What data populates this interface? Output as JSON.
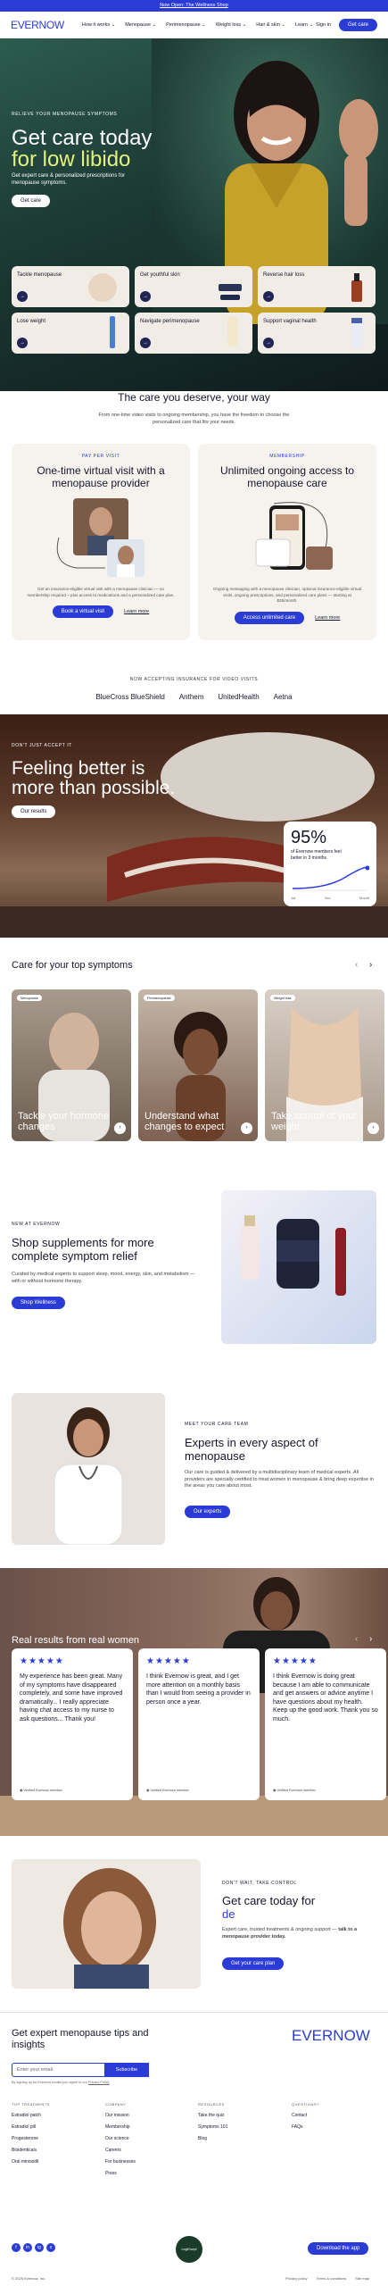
{
  "banner": {
    "text": "Now Open: The Wellness Shop"
  },
  "nav": {
    "logo": "EVERNOW",
    "items": [
      "How it works",
      "Menopause",
      "Perimenopause",
      "Weight loss",
      "Hair & skin",
      "Learn"
    ],
    "sign_in": "Sign in",
    "cta": "Get care"
  },
  "hero": {
    "eyebrow": "RELIEVE YOUR MENOPAUSE SYMPTOMS",
    "title_line1": "Get care today",
    "title_line2": "for low libido",
    "subtitle": "Get expert care & personalized prescriptions for menopause symptoms.",
    "cta": "Get care",
    "cards": [
      {
        "label": "Tackle menopause"
      },
      {
        "label": "Get youthful skin"
      },
      {
        "label": "Reverse hair loss"
      },
      {
        "label": "Lose weight"
      },
      {
        "label": "Navigate perimenopause"
      },
      {
        "label": "Support vaginal health"
      }
    ]
  },
  "care": {
    "title": "The care you deserve, your way",
    "subtitle": "From one-time video visits to ongoing membership, you have the freedom to choose the personalized care that fits your needs.",
    "cards": [
      {
        "eyebrow": "PAY PER VISIT",
        "title": "One-time virtual visit with a menopause provider",
        "desc": "Get an insurance-eligible virtual visit with a menopause clinician — no membership required – plus access to medications and a personalized care plan.",
        "cta": "Book a virtual visit",
        "link": "Learn more"
      },
      {
        "eyebrow": "MEMBERSHIP",
        "title": "Unlimited ongoing access to menopause care",
        "desc": "Ongoing messaging with a menopause clinician, optional insurance-eligible virtual visits, ongoing prescriptions, and personalized care plans — starting at $35/month.",
        "cta": "Access unlimited care",
        "link": "Learn more"
      }
    ]
  },
  "insurance": {
    "heading": "NOW ACCEPTING INSURANCE FOR VIDEO VISITS",
    "providers": [
      "BlueCross BlueShield",
      "Anthem",
      "UnitedHealth",
      "Aetna"
    ]
  },
  "feel": {
    "eyebrow": "DON'T JUST ACCEPT IT",
    "title_line1": "Feeling better is",
    "title_line2": "more than possible.",
    "cta": "Our results",
    "stat_value": "95%",
    "stat_text": "of Evernow members feel better in 3 months",
    "stat_axis": [
      "1st",
      "2nd",
      "Month"
    ]
  },
  "symptoms": {
    "title": "Care for your top symptoms",
    "cards": [
      {
        "tag": "Menopause",
        "title": "Tackle your hormone changes"
      },
      {
        "tag": "Perimenopause",
        "title": "Understand what changes to expect"
      },
      {
        "tag": "Weight loss",
        "title": "Take control of your weight"
      }
    ]
  },
  "supplements": {
    "eyebrow": "NEW AT EVERNOW",
    "title": "Shop supplements for more complete symptom relief",
    "desc": "Curated by medical experts to support sleep, mood, energy, skin, and metabolism — with or without hormone therapy.",
    "cta": "Shop Wellness"
  },
  "team": {
    "eyebrow": "MEET YOUR CARE TEAM",
    "title": "Experts in every aspect of menopause",
    "desc": "Our care is guided & delivered by a multidisciplinary team of medical experts. All providers are specially certified to treat women in menopause & bring deep expertise in the areas you care about most.",
    "cta": "Our experts"
  },
  "reviews": {
    "title": "Real results from real women",
    "items": [
      {
        "stars": "★★★★★",
        "text": "My experience has been great. Many of my symptoms have disappeared completely, and some have improved dramatically... I really appreciate having chat access to my nurse to ask questions... Thank you!",
        "verified": "Verified Evernow member"
      },
      {
        "stars": "★★★★★",
        "text": "I think Evernow is great, and I get more attention on a monthly basis than I would from seeing a provider in person once a year.",
        "verified": "Verified Evernow member"
      },
      {
        "stars": "★★★★★",
        "text": "I think Evernow is doing great because I am able to communicate and get answers or advice anytime I have questions about my health. Keep up the good work. Thank you so much.",
        "verified": "Verified Evernow member"
      }
    ]
  },
  "cta_section": {
    "eyebrow": "DON'T WAIT, TAKE CONTROL",
    "title_line1": "Get care today for",
    "title_line2": "de",
    "desc": "Expert care, trusted treatments & ongoing support —",
    "desc_bold": "talk to a menopause provider today.",
    "cta": "Get your care plan"
  },
  "newsletter": {
    "title": "Get expert menopause tips and insights",
    "placeholder": "Enter your email",
    "button": "Subscribe",
    "fine": "By signing up for Evernow emails you agree to our",
    "fine_link": "Privacy Policy"
  },
  "footer": {
    "logo": "EVERNOW",
    "columns": [
      {
        "heading": "TOP TREATMENTS",
        "links": [
          "Estradiol patch",
          "Estradiol pill",
          "Progesterone",
          "Bioidenticals",
          "Oral minoxidil"
        ]
      },
      {
        "heading": "COMPANY",
        "links": [
          "Our mission",
          "Membership",
          "Our science",
          "Careers",
          "For businesses",
          "Press"
        ]
      },
      {
        "heading": "RESOURCES",
        "links": [
          "Take the quiz",
          "Symptoms 101",
          "Blog"
        ]
      },
      {
        "heading": "QUESTIONS?",
        "links": [
          "Contact",
          "FAQs"
        ]
      }
    ],
    "social": [
      "f",
      "in",
      "ig",
      "x"
    ],
    "badge": "LegitScript",
    "app_button": "Download the app",
    "copyright": "© 2025 Evernow, Inc.",
    "legal": [
      "Privacy policy",
      "Terms & conditions",
      "Site map"
    ]
  }
}
